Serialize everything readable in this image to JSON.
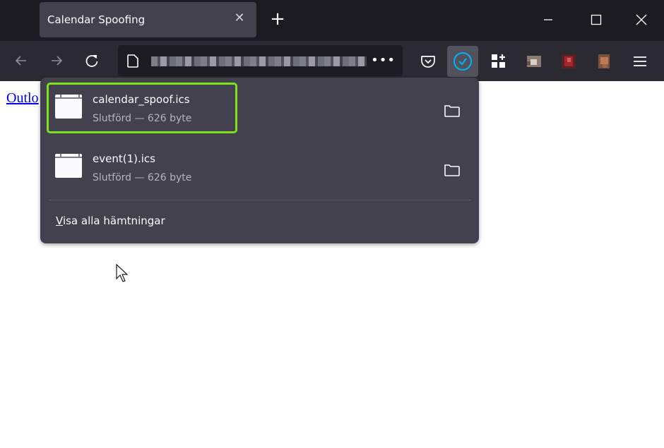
{
  "browser": {
    "tab": {
      "title": "Calendar Spoofing",
      "close_icon": "close-icon"
    },
    "new_tab_icon": "plus-icon",
    "window_controls": [
      "minimize-icon",
      "maximize-icon",
      "close-icon"
    ],
    "toolbar": {
      "back_icon": "arrow-left-icon",
      "forward_icon": "arrow-right-icon",
      "reload_icon": "reload-icon",
      "page_icon": "document-icon",
      "url": "[blurred]",
      "more_label": "•••",
      "right_icons": [
        "pocket-icon",
        "downloads-done-icon",
        "extensions-icon",
        "extension-blurred-1",
        "extension-blurred-2",
        "extension-blurred-3",
        "hamburger-menu-icon"
      ]
    }
  },
  "page": {
    "link_text": "Outlo"
  },
  "downloads_panel": {
    "items": [
      {
        "filename": "calendar_spoof.ics",
        "status": "Slutförd — 626 byte",
        "highlighted": true
      },
      {
        "filename": "event(1).ics",
        "status": "Slutförd — 626 byte",
        "highlighted": false
      }
    ],
    "show_all": {
      "accesskey": "V",
      "rest": "isa alla hämtningar"
    }
  },
  "colors": {
    "highlight": "#7ee21b",
    "accent": "#00b3f4",
    "panel_bg": "#42414d"
  }
}
